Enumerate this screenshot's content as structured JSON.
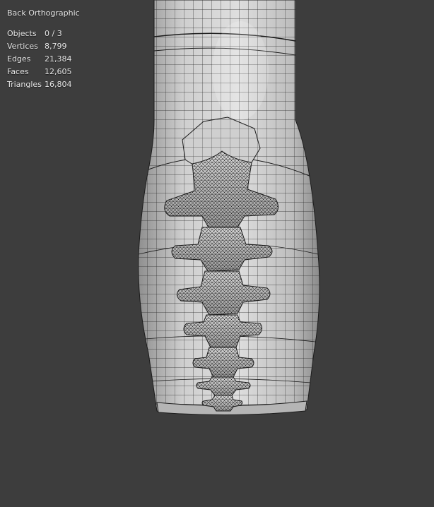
{
  "viewport": {
    "view_name": "Back Orthographic",
    "background": "#3d3d3d"
  },
  "stats": [
    {
      "label": "Objects",
      "value": "0 / 3"
    },
    {
      "label": "Vertices",
      "value": "8,799"
    },
    {
      "label": "Edges",
      "value": "21,384"
    },
    {
      "label": "Faces",
      "value": "12,605"
    },
    {
      "label": "Triangles",
      "value": "16,804"
    }
  ]
}
